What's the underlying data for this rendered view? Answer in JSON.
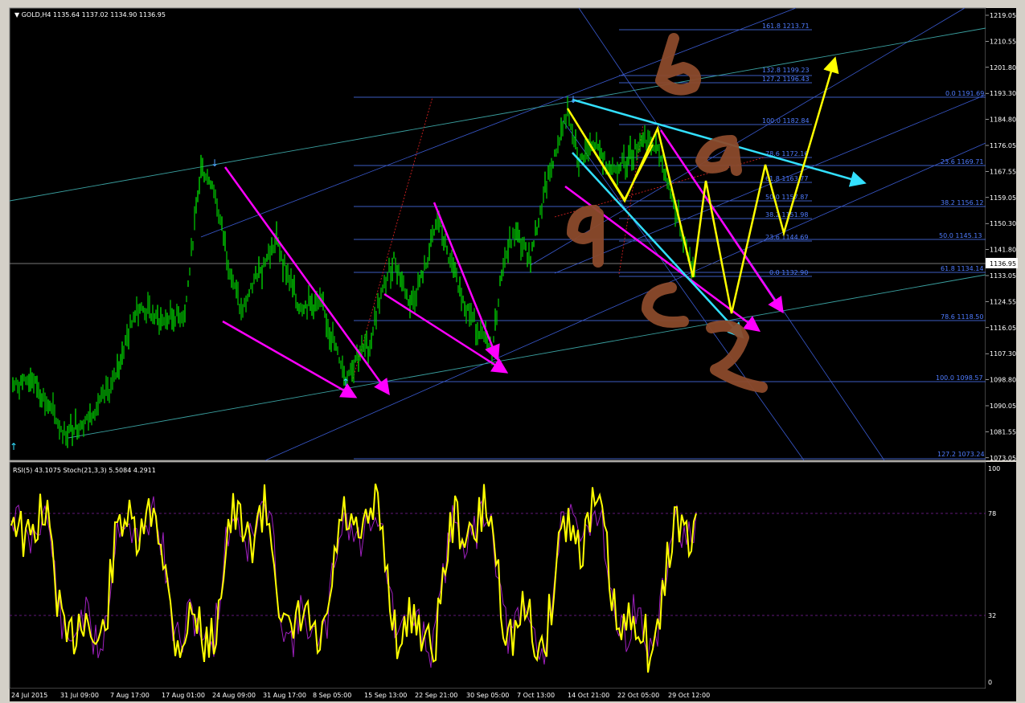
{
  "header": {
    "symbol_label": "GOLD,H4",
    "ohlc": "1135.64 1137.02 1134.90 1136.95",
    "arrow": "▼"
  },
  "price_axis": {
    "ticks": [
      "1219.05",
      "1210.55",
      "1201.80",
      "1193.30",
      "1184.80",
      "1176.05",
      "1167.55",
      "1159.05",
      "1150.30",
      "1141.80",
      "1133.05",
      "1124.55",
      "1116.05",
      "1107.30",
      "1098.80",
      "1090.05",
      "1081.55",
      "1073.05"
    ],
    "current_price": "1136.95"
  },
  "fib_left": [
    {
      "label": "161.8 1213.71"
    },
    {
      "label": "132.8 1199.23"
    },
    {
      "label": "127.2 1196.43"
    },
    {
      "label": "100.0 1182.84"
    },
    {
      "label": "78.6 1172.16"
    },
    {
      "label": "61.8 1163.77"
    },
    {
      "label": "50.0 1157.87"
    },
    {
      "label": "38.2 1151.98"
    },
    {
      "label": "23.6 1144.69"
    },
    {
      "label": "0.0 1132.90"
    }
  ],
  "fib_right": [
    {
      "label": "0.0 1191.69"
    },
    {
      "label": "23.6 1169.71"
    },
    {
      "label": "38.2 1156.12"
    },
    {
      "label": "50.0 1145.13"
    },
    {
      "label": "61.8 1134.14"
    },
    {
      "label": "78.6 1118.50"
    },
    {
      "label": "100.0 1098.57"
    },
    {
      "label": "127.2 1073.24"
    }
  ],
  "indicator": {
    "label": "RSI(5) 43.1075  Stoch(21,3,3) 5.5084 4.2911",
    "levels": [
      "100",
      "78",
      "32",
      "0"
    ]
  },
  "time_axis": {
    "labels": [
      "24 Jul 2015",
      "31 Jul 09:00",
      "7 Aug 17:00",
      "17 Aug 01:00",
      "24 Aug 09:00",
      "31 Aug 17:00",
      "8 Sep 05:00",
      "15 Sep 13:00",
      "22 Sep 21:00",
      "30 Sep 05:00",
      "7 Oct 13:00",
      "14 Oct 21:00",
      "22 Oct 05:00",
      "29 Oct 12:00"
    ]
  },
  "handwritten": [
    "b",
    "a",
    "a",
    "c",
    "2"
  ],
  "colors": {
    "background": "#000000",
    "candles": "#00c000",
    "fib": "#4f7cff",
    "channel": "#3aa0a0",
    "magenta": "#ff00ff",
    "yellow": "#ffff00",
    "cyan": "#33e0ff",
    "brown": "#8b4a2b"
  }
}
